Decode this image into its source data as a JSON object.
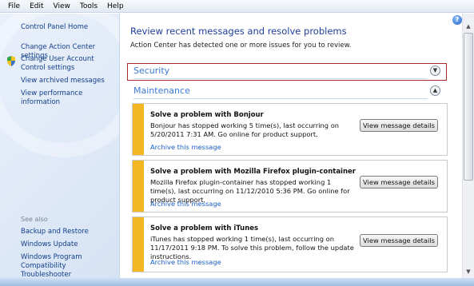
{
  "menu": [
    "File",
    "Edit",
    "View",
    "Tools",
    "Help"
  ],
  "sidebar": {
    "home": "Control Panel Home",
    "links": [
      "Change Action Center settings",
      "Change User Account Control settings",
      "View archived messages",
      "View performance information"
    ],
    "see_also_label": "See also",
    "see_also": [
      "Backup and Restore",
      "Windows Update",
      "Windows Program Compatibility Troubleshooter"
    ]
  },
  "main": {
    "heading": "Review recent messages and resolve problems",
    "subtitle": "Action Center has detected one or more issues for you to review.",
    "security_label": "Security",
    "maintenance_label": "Maintenance",
    "cards": [
      {
        "title": "Solve a problem with Bonjour",
        "desc": "Bonjour has stopped working  5 time(s), last occurring on 5/20/2011 7:31 AM.  Go online for product support.",
        "archive": "Archive this message",
        "button": "View message details"
      },
      {
        "title": "Solve a problem with Mozilla Firefox plugin-container",
        "desc": "Mozilla Firefox plugin-container has stopped working  1 time(s), last occurring on 11/12/2010 5:36 PM.  Go online for product support.",
        "archive": "Archive this message",
        "button": "View message details"
      },
      {
        "title": "Solve a problem with iTunes",
        "desc": "iTunes has stopped working  1 time(s), last occurring on 11/17/2011 9:18 PM.  To solve this problem, follow the update instructions.",
        "archive": "Archive this message",
        "button": "View message details"
      }
    ]
  },
  "colors": {
    "accent_link": "#123f8a",
    "heading_blue": "#1f3f9a",
    "section_blue": "#3b7ad6",
    "warning_bar": "#f4b724",
    "highlight_border": "#a52a2a"
  }
}
